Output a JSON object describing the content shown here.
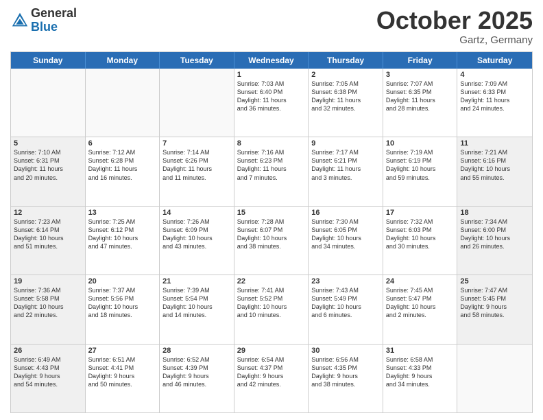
{
  "header": {
    "logo_general": "General",
    "logo_blue": "Blue",
    "month": "October 2025",
    "location": "Gartz, Germany"
  },
  "weekdays": [
    "Sunday",
    "Monday",
    "Tuesday",
    "Wednesday",
    "Thursday",
    "Friday",
    "Saturday"
  ],
  "rows": [
    [
      {
        "day": "",
        "info": "",
        "empty": true
      },
      {
        "day": "",
        "info": "",
        "empty": true
      },
      {
        "day": "",
        "info": "",
        "empty": true
      },
      {
        "day": "1",
        "info": "Sunrise: 7:03 AM\nSunset: 6:40 PM\nDaylight: 11 hours\nand 36 minutes."
      },
      {
        "day": "2",
        "info": "Sunrise: 7:05 AM\nSunset: 6:38 PM\nDaylight: 11 hours\nand 32 minutes."
      },
      {
        "day": "3",
        "info": "Sunrise: 7:07 AM\nSunset: 6:35 PM\nDaylight: 11 hours\nand 28 minutes."
      },
      {
        "day": "4",
        "info": "Sunrise: 7:09 AM\nSunset: 6:33 PM\nDaylight: 11 hours\nand 24 minutes."
      }
    ],
    [
      {
        "day": "5",
        "info": "Sunrise: 7:10 AM\nSunset: 6:31 PM\nDaylight: 11 hours\nand 20 minutes.",
        "shaded": true
      },
      {
        "day": "6",
        "info": "Sunrise: 7:12 AM\nSunset: 6:28 PM\nDaylight: 11 hours\nand 16 minutes."
      },
      {
        "day": "7",
        "info": "Sunrise: 7:14 AM\nSunset: 6:26 PM\nDaylight: 11 hours\nand 11 minutes."
      },
      {
        "day": "8",
        "info": "Sunrise: 7:16 AM\nSunset: 6:23 PM\nDaylight: 11 hours\nand 7 minutes."
      },
      {
        "day": "9",
        "info": "Sunrise: 7:17 AM\nSunset: 6:21 PM\nDaylight: 11 hours\nand 3 minutes."
      },
      {
        "day": "10",
        "info": "Sunrise: 7:19 AM\nSunset: 6:19 PM\nDaylight: 10 hours\nand 59 minutes."
      },
      {
        "day": "11",
        "info": "Sunrise: 7:21 AM\nSunset: 6:16 PM\nDaylight: 10 hours\nand 55 minutes.",
        "shaded": true
      }
    ],
    [
      {
        "day": "12",
        "info": "Sunrise: 7:23 AM\nSunset: 6:14 PM\nDaylight: 10 hours\nand 51 minutes.",
        "shaded": true
      },
      {
        "day": "13",
        "info": "Sunrise: 7:25 AM\nSunset: 6:12 PM\nDaylight: 10 hours\nand 47 minutes."
      },
      {
        "day": "14",
        "info": "Sunrise: 7:26 AM\nSunset: 6:09 PM\nDaylight: 10 hours\nand 43 minutes."
      },
      {
        "day": "15",
        "info": "Sunrise: 7:28 AM\nSunset: 6:07 PM\nDaylight: 10 hours\nand 38 minutes."
      },
      {
        "day": "16",
        "info": "Sunrise: 7:30 AM\nSunset: 6:05 PM\nDaylight: 10 hours\nand 34 minutes."
      },
      {
        "day": "17",
        "info": "Sunrise: 7:32 AM\nSunset: 6:03 PM\nDaylight: 10 hours\nand 30 minutes."
      },
      {
        "day": "18",
        "info": "Sunrise: 7:34 AM\nSunset: 6:00 PM\nDaylight: 10 hours\nand 26 minutes.",
        "shaded": true
      }
    ],
    [
      {
        "day": "19",
        "info": "Sunrise: 7:36 AM\nSunset: 5:58 PM\nDaylight: 10 hours\nand 22 minutes.",
        "shaded": true
      },
      {
        "day": "20",
        "info": "Sunrise: 7:37 AM\nSunset: 5:56 PM\nDaylight: 10 hours\nand 18 minutes."
      },
      {
        "day": "21",
        "info": "Sunrise: 7:39 AM\nSunset: 5:54 PM\nDaylight: 10 hours\nand 14 minutes."
      },
      {
        "day": "22",
        "info": "Sunrise: 7:41 AM\nSunset: 5:52 PM\nDaylight: 10 hours\nand 10 minutes."
      },
      {
        "day": "23",
        "info": "Sunrise: 7:43 AM\nSunset: 5:49 PM\nDaylight: 10 hours\nand 6 minutes."
      },
      {
        "day": "24",
        "info": "Sunrise: 7:45 AM\nSunset: 5:47 PM\nDaylight: 10 hours\nand 2 minutes."
      },
      {
        "day": "25",
        "info": "Sunrise: 7:47 AM\nSunset: 5:45 PM\nDaylight: 9 hours\nand 58 minutes.",
        "shaded": true
      }
    ],
    [
      {
        "day": "26",
        "info": "Sunrise: 6:49 AM\nSunset: 4:43 PM\nDaylight: 9 hours\nand 54 minutes.",
        "shaded": true
      },
      {
        "day": "27",
        "info": "Sunrise: 6:51 AM\nSunset: 4:41 PM\nDaylight: 9 hours\nand 50 minutes."
      },
      {
        "day": "28",
        "info": "Sunrise: 6:52 AM\nSunset: 4:39 PM\nDaylight: 9 hours\nand 46 minutes."
      },
      {
        "day": "29",
        "info": "Sunrise: 6:54 AM\nSunset: 4:37 PM\nDaylight: 9 hours\nand 42 minutes."
      },
      {
        "day": "30",
        "info": "Sunrise: 6:56 AM\nSunset: 4:35 PM\nDaylight: 9 hours\nand 38 minutes."
      },
      {
        "day": "31",
        "info": "Sunrise: 6:58 AM\nSunset: 4:33 PM\nDaylight: 9 hours\nand 34 minutes."
      },
      {
        "day": "",
        "info": "",
        "empty": true
      }
    ]
  ]
}
